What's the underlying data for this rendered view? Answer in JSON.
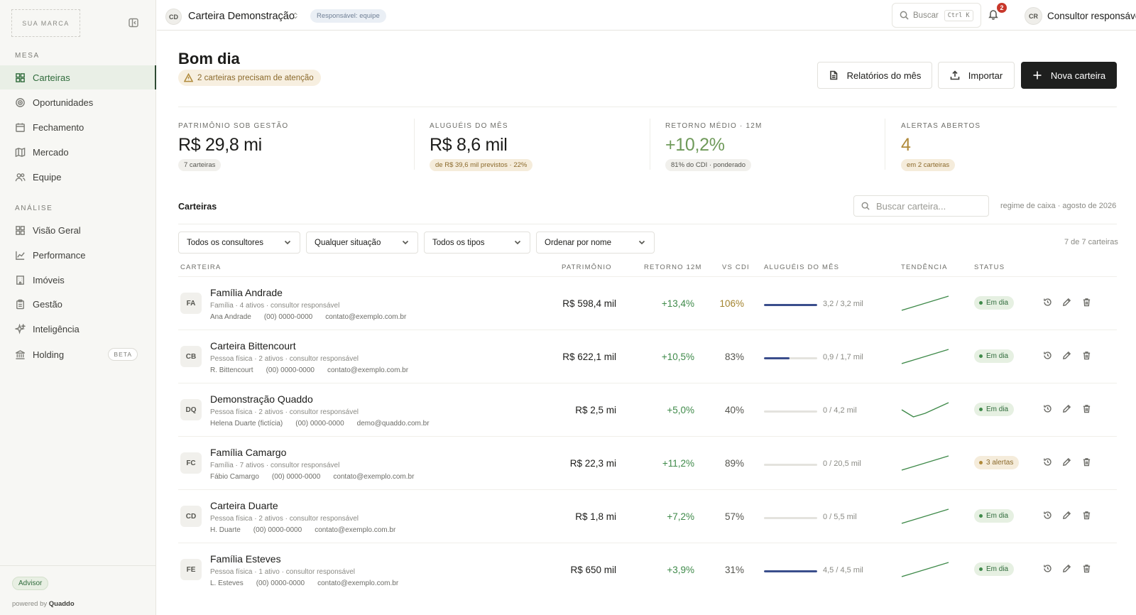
{
  "sidebar": {
    "brand": "SUA MARCA",
    "section_mesa": "MESA",
    "section_analise": "ANÁLISE",
    "items_mesa": [
      {
        "label": "Carteiras",
        "icon": "grid-icon"
      },
      {
        "label": "Oportunidades",
        "icon": "target-icon"
      },
      {
        "label": "Fechamento",
        "icon": "calendar-icon"
      },
      {
        "label": "Mercado",
        "icon": "map-icon"
      },
      {
        "label": "Equipe",
        "icon": "users-icon"
      }
    ],
    "items_analise": [
      {
        "label": "Visão Geral",
        "icon": "grid-icon"
      },
      {
        "label": "Performance",
        "icon": "chart-line-icon"
      },
      {
        "label": "Imóveis",
        "icon": "building-icon"
      },
      {
        "label": "Gestão",
        "icon": "clipboard-icon"
      },
      {
        "label": "Inteligência",
        "icon": "sparkle-icon"
      },
      {
        "label": "Holding",
        "icon": "bank-icon",
        "badge": "BETA"
      }
    ],
    "advisor_badge": "Advisor",
    "powered_prefix": "powered by",
    "powered_brand": "Quaddo"
  },
  "topbar": {
    "workspace_initials": "CD",
    "workspace_name": "Carteira Demonstração",
    "responsible_badge": "Responsável: equipe",
    "search_label": "Buscar",
    "search_shortcut": "Ctrl K",
    "notifications_count": "2",
    "user_initials": "CR",
    "user_name": "Consultor responsável"
  },
  "header": {
    "greeting": "Bom dia",
    "attention": "2 carteiras precisam de atenção",
    "btn_reports": "Relatórios do mês",
    "btn_import": "Importar",
    "btn_new": "Nova carteira"
  },
  "kpis": [
    {
      "label": "PATRIMÔNIO SOB GESTÃO",
      "value": "R$ 29,8 mi",
      "sub": "7 carteiras",
      "value_color": "#1c1c1a",
      "sub_style": "neutral"
    },
    {
      "label": "ALUGUÉIS DO MÊS",
      "value": "R$ 8,6 mil",
      "sub": "de R$ 39,6 mil previstos · 22%",
      "value_color": "#1c1c1a",
      "sub_style": "warm"
    },
    {
      "label": "RETORNO MÉDIO · 12M",
      "value": "+10,2%",
      "sub": "81% do CDI · ponderado",
      "value_color": "#6f9a5a",
      "sub_style": "neutral"
    },
    {
      "label": "ALERTAS ABERTOS",
      "value": "4",
      "sub": "em 2 carteiras",
      "value_color": "#b08a3a",
      "sub_style": "warm"
    }
  ],
  "wallets_section": {
    "title": "Carteiras",
    "search_placeholder": "Buscar carteira...",
    "regime": "regime de caixa · agosto de 2026",
    "filters": [
      "Todos os consultores",
      "Qualquer situação",
      "Todos os tipos",
      "Ordenar por nome"
    ],
    "count": "7 de 7 carteiras"
  },
  "table": {
    "headers": {
      "carteira": "CARTEIRA",
      "patrimonio": "PATRIMÔNIO",
      "retorno": "RETORNO 12M",
      "cdi": "VS CDI",
      "alugueis": "ALUGUÉIS DO MÊS",
      "tendencia": "TENDÊNCIA",
      "status": "STATUS"
    },
    "rows": [
      {
        "initials": "FA",
        "name": "Família Andrade",
        "meta": "Família · 4 ativos · consultor responsável",
        "contact_name": "Ana Andrade",
        "phone": "(00) 0000-0000",
        "email": "contato@exemplo.com.br",
        "patrimonio": "R$ 598,4 mil",
        "retorno": "+13,4%",
        "cdi": "106%",
        "cdi_highlight": true,
        "rent_label": "3,2 / 3,2 mil",
        "rent_fraction": 1.0,
        "trend": [
          10,
          12,
          14,
          16,
          18
        ],
        "status": "Em dia",
        "status_kind": "ok"
      },
      {
        "initials": "CB",
        "name": "Carteira Bittencourt",
        "meta": "Pessoa física · 2 ativos · consultor responsável",
        "contact_name": "R. Bittencourt",
        "phone": "(00) 0000-0000",
        "email": "contato@exemplo.com.br",
        "patrimonio": "R$ 622,1 mil",
        "retorno": "+10,5%",
        "cdi": "83%",
        "cdi_highlight": false,
        "rent_label": "0,9 / 1,7 mil",
        "rent_fraction": 0.48,
        "trend": [
          10,
          12,
          14,
          16,
          18
        ],
        "status": "Em dia",
        "status_kind": "ok"
      },
      {
        "initials": "DQ",
        "name": "Demonstração Quaddo",
        "meta": "Pessoa física · 2 ativos · consultor responsável",
        "contact_name": "Helena Duarte (fictícia)",
        "phone": "(00) 0000-0000",
        "email": "demo@quaddo.com.br",
        "patrimonio": "R$ 2,5 mi",
        "retorno": "+5,0%",
        "cdi": "40%",
        "cdi_highlight": false,
        "rent_label": "0 / 4,2 mil",
        "rent_fraction": 0,
        "trend": [
          14,
          10,
          12,
          15,
          18
        ],
        "status": "Em dia",
        "status_kind": "ok"
      },
      {
        "initials": "FC",
        "name": "Família Camargo",
        "meta": "Família · 7 ativos · consultor responsável",
        "contact_name": "Fábio Camargo",
        "phone": "(00) 0000-0000",
        "email": "contato@exemplo.com.br",
        "patrimonio": "R$ 22,3 mi",
        "retorno": "+11,2%",
        "cdi": "89%",
        "cdi_highlight": false,
        "rent_label": "0 / 20,5 mil",
        "rent_fraction": 0,
        "trend": [
          10,
          12,
          14,
          16,
          18
        ],
        "status": "3 alertas",
        "status_kind": "warn"
      },
      {
        "initials": "CD",
        "name": "Carteira Duarte",
        "meta": "Pessoa física · 2 ativos · consultor responsável",
        "contact_name": "H. Duarte",
        "phone": "(00) 0000-0000",
        "email": "contato@exemplo.com.br",
        "patrimonio": "R$ 1,8 mi",
        "retorno": "+7,2%",
        "cdi": "57%",
        "cdi_highlight": false,
        "rent_label": "0 / 5,5 mil",
        "rent_fraction": 0,
        "trend": [
          10,
          12,
          14,
          16,
          18
        ],
        "status": "Em dia",
        "status_kind": "ok"
      },
      {
        "initials": "FE",
        "name": "Família Esteves",
        "meta": "Pessoa física · 1 ativo · consultor responsável",
        "contact_name": "L. Esteves",
        "phone": "(00) 0000-0000",
        "email": "contato@exemplo.com.br",
        "patrimonio": "R$ 650 mil",
        "retorno": "+3,9%",
        "cdi": "31%",
        "cdi_highlight": false,
        "rent_label": "4,5 / 4,5 mil",
        "rent_fraction": 1.0,
        "trend": [
          10,
          12,
          14,
          16,
          18
        ],
        "status": "Em dia",
        "status_kind": "ok"
      }
    ]
  }
}
